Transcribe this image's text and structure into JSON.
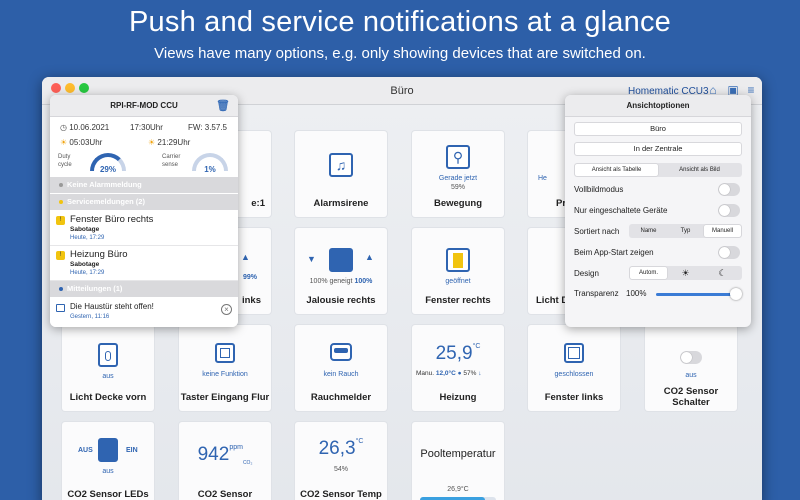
{
  "headline": "Push and service notifications at a glance",
  "subline": "Views have many options, e.g. only showing devices that are switched on.",
  "window": {
    "title": "Büro",
    "ccu_label": "Homematic CCU3"
  },
  "colors": {
    "background": "#2d5fa8",
    "accent": "#2f64b1",
    "warning": "#f1c40f",
    "progress": "#3aa0e0"
  },
  "tiles": {
    "t1": {
      "name": "e:1"
    },
    "alarm": {
      "name": "Alarmsirene"
    },
    "motion": {
      "state": "Gerade jetzt",
      "pct": "59%",
      "name": "Bewegung"
    },
    "partial1": {
      "state": "He",
      "name": "Pr"
    },
    "links": {
      "pct": "99%",
      "name": "inks"
    },
    "jalousie": {
      "state_a": "100% geneigt",
      "state_b": "100%",
      "name": "Jalousie rechts"
    },
    "fenster_r": {
      "state": "geöffnet",
      "name": "Fenster rechts"
    },
    "licht_d": {
      "name": "Licht D"
    },
    "licht": {
      "state": "aus",
      "name": "Licht Decke vorn"
    },
    "taster": {
      "state": "keine Funktion",
      "name": "Taster Eingang Flur"
    },
    "rauch": {
      "state": "kein Rauch",
      "name": "Rauchmelder"
    },
    "heizung": {
      "value": "25,9",
      "unit": "°C",
      "mode": "Manu.",
      "setpoint": "12,0°C",
      "humidity": "57%",
      "name": "Heizung"
    },
    "fenster_l": {
      "state": "geschlossen",
      "name": "Fenster links"
    },
    "co2s": {
      "state": "aus",
      "name": "CO2 Sensor Schalter"
    },
    "co2led": {
      "left": "AUS",
      "right": "EIN",
      "state": "aus",
      "name": "CO2 Sensor LEDs"
    },
    "co2": {
      "value": "942",
      "unit": "ppm",
      "unit2": "CO₂",
      "name": "CO2 Sensor"
    },
    "co2temp": {
      "value": "26,3",
      "unit": "°C",
      "humidity": "54%",
      "name": "CO2 Sensor Temp"
    },
    "pool": {
      "name": "Pooltemperatur",
      "value": "26,9°C",
      "progress": 0.85
    }
  },
  "left_popover": {
    "title": "RPI-RF-MOD CCU",
    "date": "10.06.2021",
    "time": "17:30Uhr",
    "fw": "FW: 3.57.5",
    "sunrise": "05:03Uhr",
    "sunset": "21:29Uhr",
    "duty_label": "Duty cycle",
    "duty_value": "29%",
    "carrier_label": "Carrier sense",
    "carrier_value": "1%",
    "sections": {
      "alarm": "Keine Alarmmeldung",
      "service": "Servicemeldungen (2)",
      "messages": "Mitteilungen (1)"
    },
    "items": [
      {
        "title": "Fenster Büro rechts",
        "sub": "Sabotage",
        "time": "Heute, 17:29"
      },
      {
        "title": "Heizung Büro",
        "sub": "Sabotage",
        "time": "Heute, 17:29"
      }
    ],
    "message": {
      "title": "Die Haustür steht offen!",
      "time": "Gestern, 11:16"
    }
  },
  "right_popover": {
    "title": "Ansichtoptionen",
    "room": "Büro",
    "central": "In der Zentrale",
    "view_table": "Ansicht als Tabelle",
    "view_image": "Ansicht als Bild",
    "fullscreen": "Vollbildmodus",
    "only_on": "Nur eingeschaltete Geräte",
    "sort_label": "Sortiert nach",
    "sort_name": "Name",
    "sort_type": "Typ",
    "sort_manual": "Manuell",
    "startup": "Beim App-Start zeigen",
    "design_label": "Design",
    "design_auto": "Autom.",
    "transp_label": "Transparenz",
    "transp_value": "100%"
  }
}
